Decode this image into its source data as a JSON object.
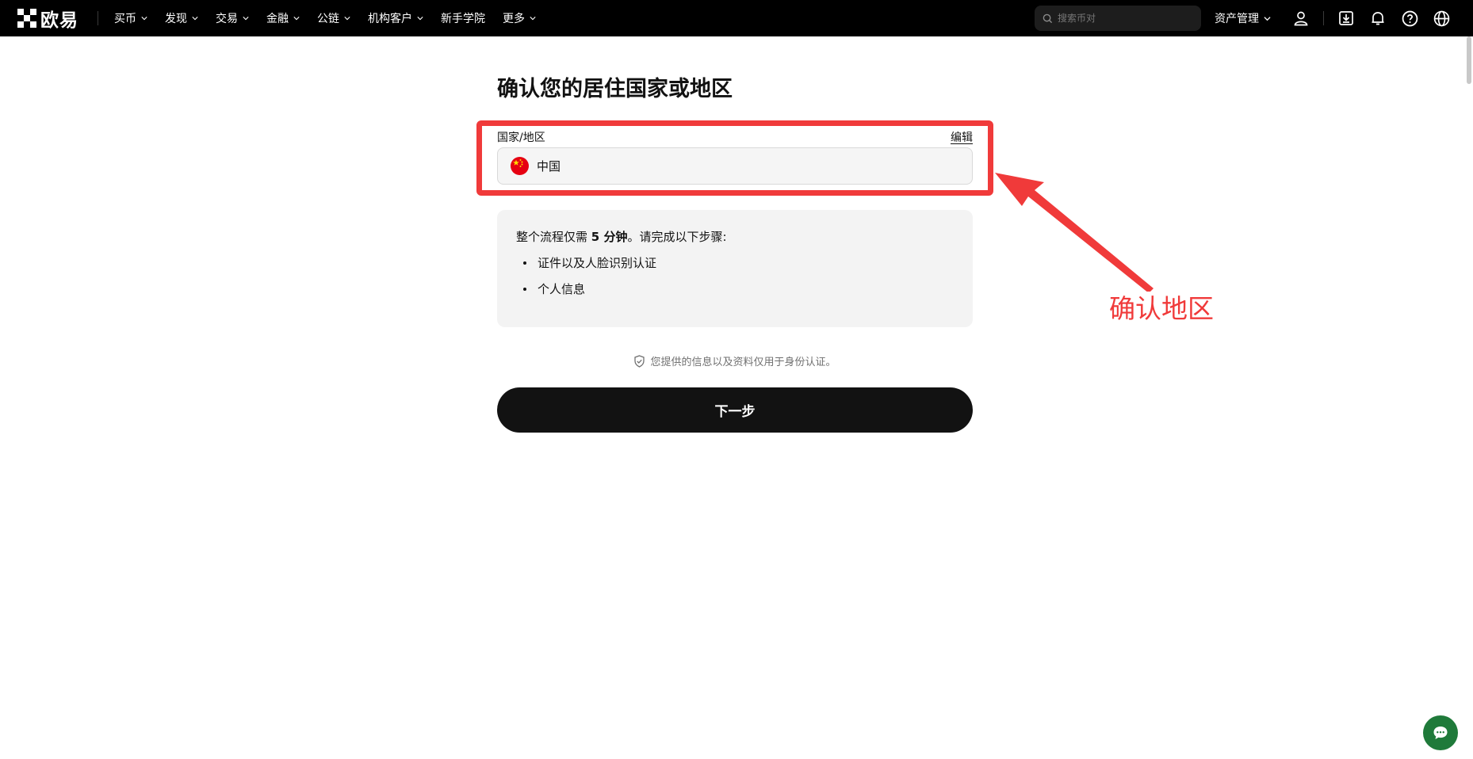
{
  "brand": {
    "name": "欧易"
  },
  "nav": {
    "items": [
      {
        "label": "买币",
        "has_dropdown": true
      },
      {
        "label": "发现",
        "has_dropdown": true
      },
      {
        "label": "交易",
        "has_dropdown": true
      },
      {
        "label": "金融",
        "has_dropdown": true
      },
      {
        "label": "公链",
        "has_dropdown": true
      },
      {
        "label": "机构客户",
        "has_dropdown": true
      },
      {
        "label": "新手学院",
        "has_dropdown": false
      },
      {
        "label": "更多",
        "has_dropdown": true
      }
    ],
    "search_placeholder": "搜索币对",
    "assets_label": "资产管理",
    "icons": [
      "search-icon",
      "user-icon",
      "download-icon",
      "bell-icon",
      "help-icon",
      "globe-icon"
    ]
  },
  "form": {
    "title": "确认您的居住国家或地区",
    "field_label": "国家/地区",
    "edit_label": "编辑",
    "country_value": "中国",
    "country_flag": "china-flag-icon"
  },
  "info": {
    "title_prefix": "整个流程仅需 ",
    "title_bold": "5 分钟",
    "title_suffix": "。请完成以下步骤:",
    "steps": [
      "证件以及人脸识别认证",
      "个人信息"
    ]
  },
  "privacy_note": "您提供的信息以及资料仅用于身份认证。",
  "next_button": "下一步",
  "annotation": {
    "text": "确认地区",
    "color": "#f03a3a"
  },
  "colors": {
    "topbar": "#000000",
    "primary_button": "#121212",
    "chat_button": "#1f7a3a"
  }
}
